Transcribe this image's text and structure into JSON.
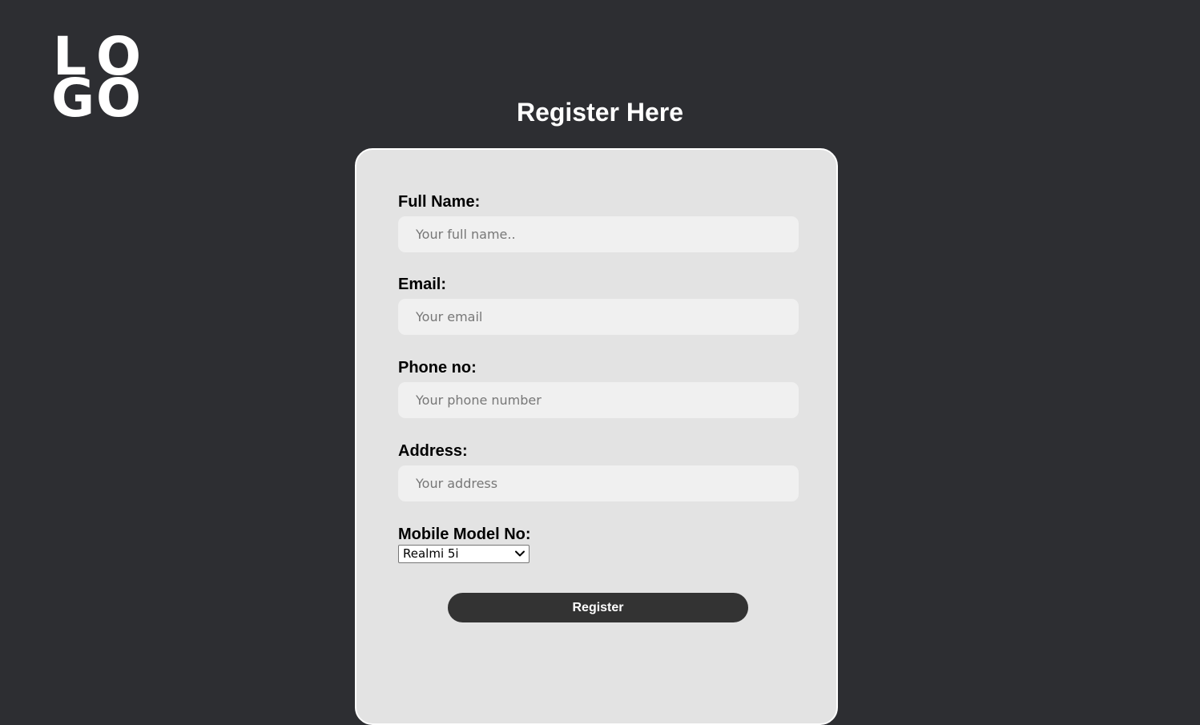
{
  "logo": {
    "letters": [
      "L",
      "O",
      "G",
      "O"
    ]
  },
  "page_title": "Register Here",
  "form": {
    "full_name": {
      "label": "Full Name:",
      "placeholder": "Your full name..",
      "value": ""
    },
    "email": {
      "label": "Email:",
      "placeholder": "Your email",
      "value": ""
    },
    "phone": {
      "label": "Phone no:",
      "placeholder": "Your phone number",
      "value": ""
    },
    "address": {
      "label": "Address:",
      "placeholder": "Your address",
      "value": ""
    },
    "mobile_model": {
      "label": "Mobile Model No:",
      "selected": "Realmi 5i",
      "icon": "chevron-down-icon"
    },
    "submit_label": "Register"
  },
  "colors": {
    "background": "#2d2e32",
    "card": "#e3e3e3",
    "input": "#f0f0f0",
    "button": "#333333",
    "text_light": "#ffffff"
  }
}
